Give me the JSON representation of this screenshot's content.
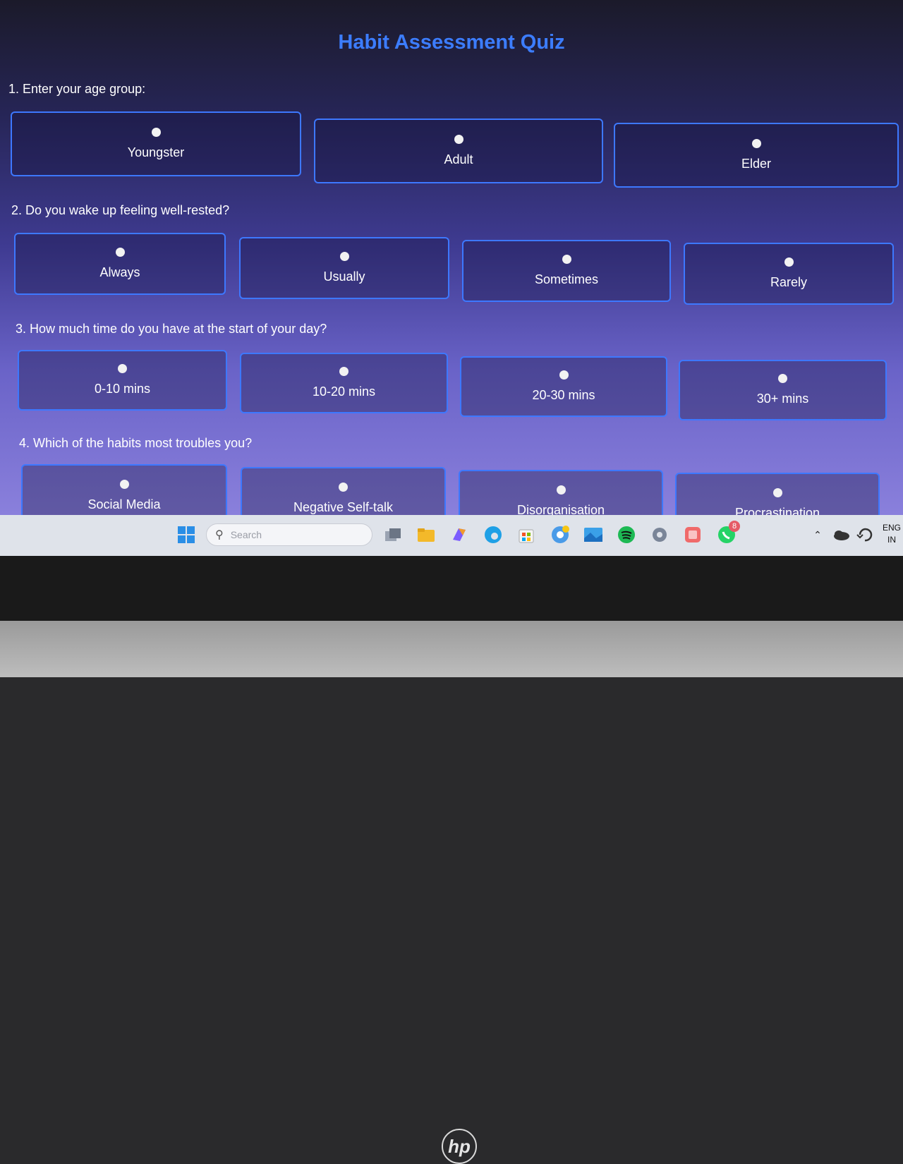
{
  "page": {
    "title": "Habit Assessment Quiz"
  },
  "questions": [
    {
      "text": "1. Enter your age group:",
      "options": [
        "Youngster",
        "Adult",
        "Elder"
      ]
    },
    {
      "text": "2. Do you wake up feeling well-rested?",
      "options": [
        "Always",
        "Usually",
        "Sometimes",
        "Rarely"
      ]
    },
    {
      "text": "3. How much time do you have at the start of your day?",
      "options": [
        "0-10 mins",
        "10-20 mins",
        "20-30 mins",
        "30+ mins"
      ]
    },
    {
      "text": "4. Which of the habits most troubles you?",
      "options": [
        "Social Media",
        "Negative Self-talk",
        "Disorganisation",
        "Procrastination"
      ]
    }
  ],
  "taskbar": {
    "search_placeholder": "Search",
    "whatsapp_badge": "8",
    "language": "ENG",
    "region": "IN",
    "icons": [
      "windows-start-icon",
      "search-icon",
      "task-view-icon",
      "file-explorer-icon",
      "copilot-icon",
      "edge-icon",
      "store-icon",
      "chrome-icon",
      "photos-icon",
      "spotify-icon",
      "settings-icon",
      "app-icon",
      "whatsapp-icon",
      "chevron-up-icon",
      "onedrive-icon",
      "sync-icon"
    ]
  },
  "device": {
    "brand": "hp"
  },
  "colors": {
    "accent": "#3d78ff",
    "title": "#3c7dff"
  }
}
